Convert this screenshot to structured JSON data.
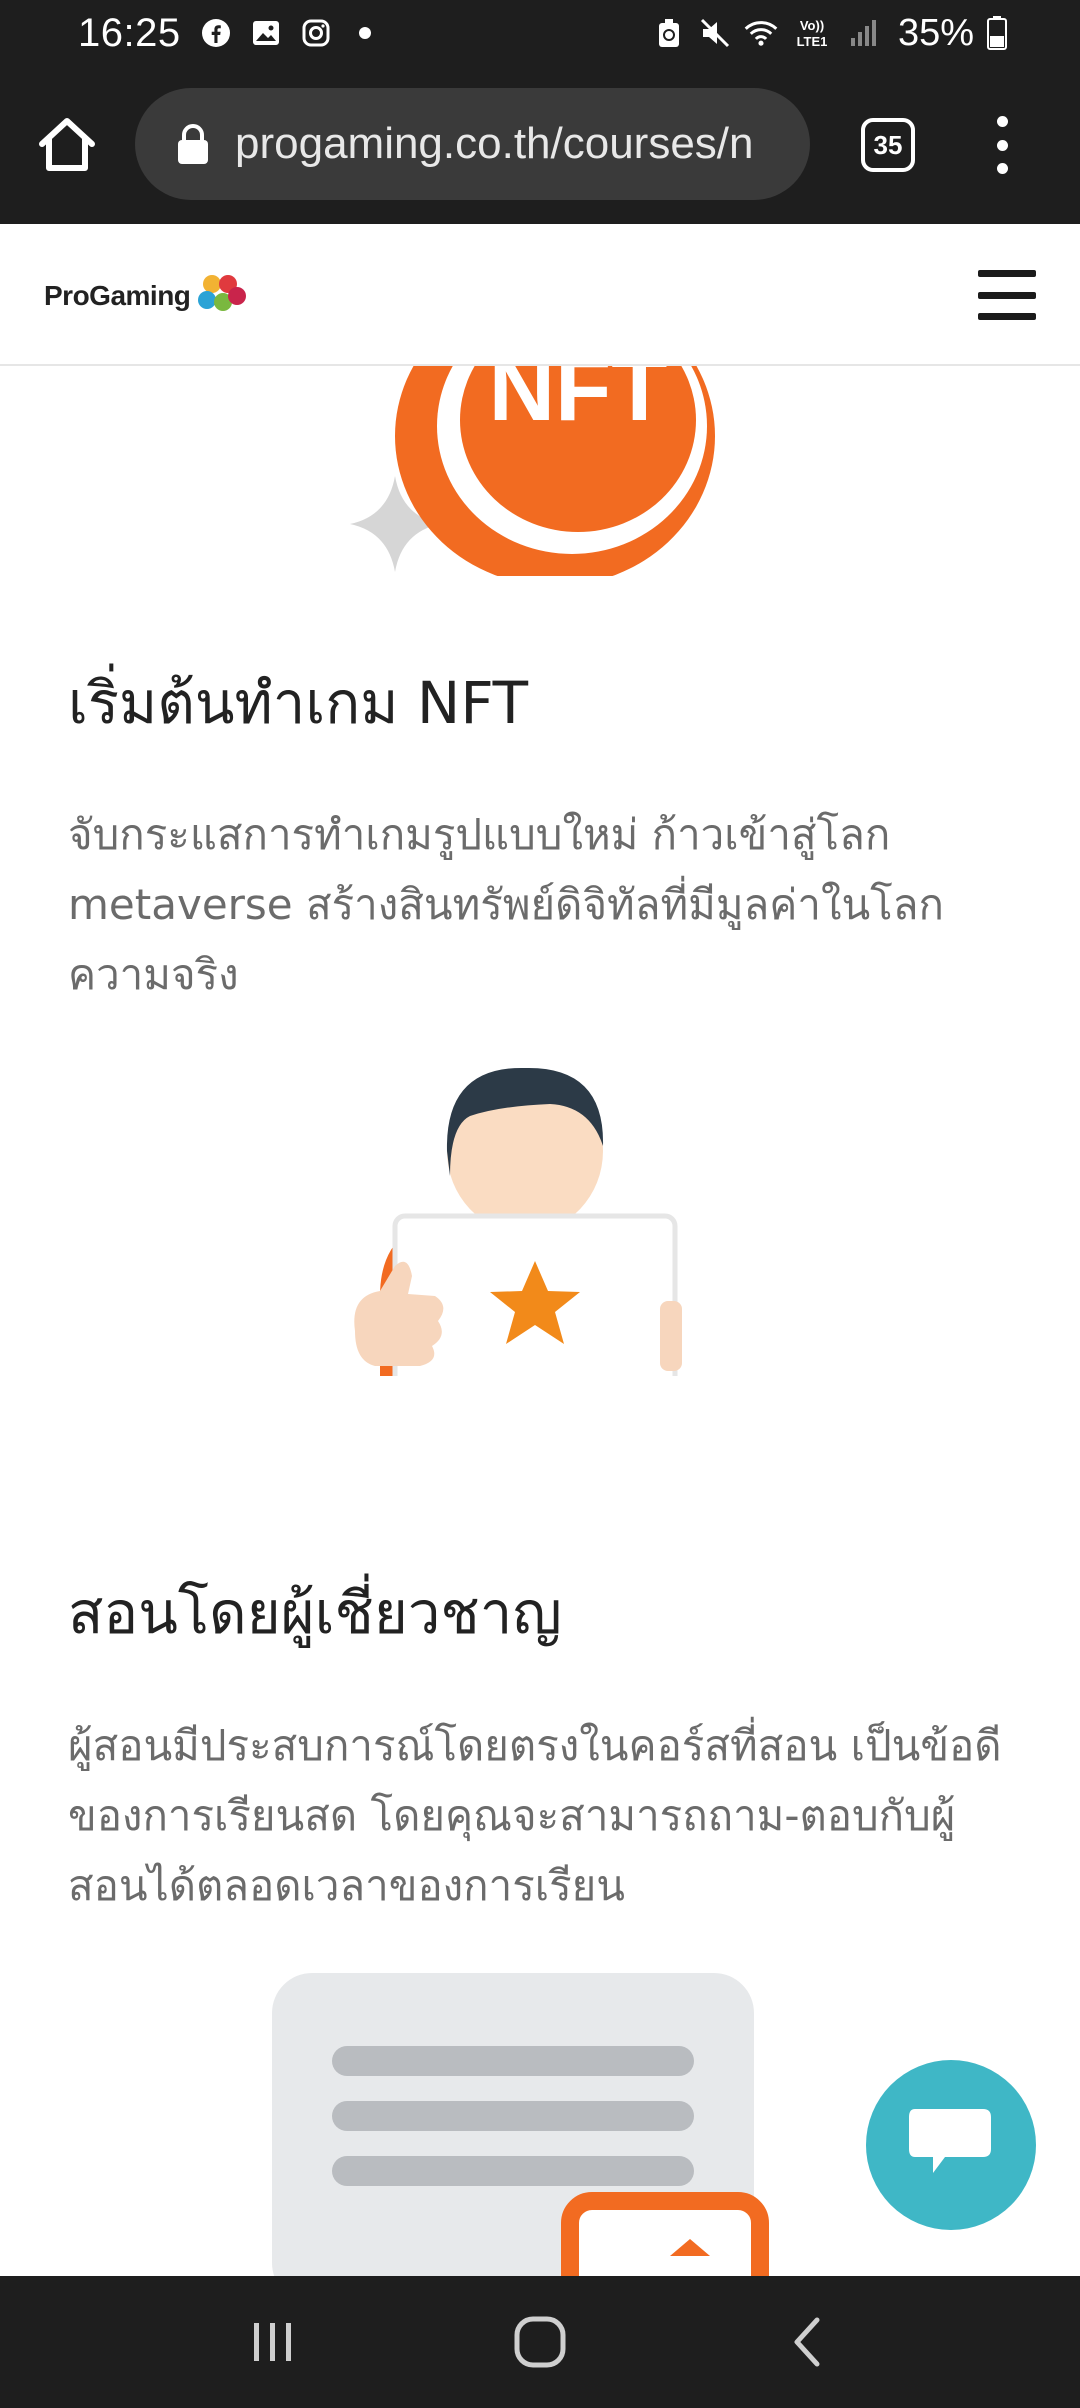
{
  "status_bar": {
    "time": "16:25",
    "battery": "35%",
    "icons_left": [
      "facebook-icon",
      "gallery-icon",
      "instagram-icon",
      "dot-icon"
    ],
    "icons_right": [
      "recycle-icon",
      "mute-icon",
      "wifi-icon",
      "volte-icon",
      "signal-icon",
      "battery-icon"
    ],
    "volte_label": "Vo) LTE1"
  },
  "browser": {
    "url": "progaming.co.th/courses/n",
    "tab_count": "35"
  },
  "site": {
    "logo_text": "ProGaming"
  },
  "sections": [
    {
      "title": "เริ่มต้นทำเกม NFT",
      "description": "จับกระแสการทำเกมรูปแบบใหม่ ก้าวเข้าสู่โลก metaverse สร้างสินทรัพย์ดิจิทัลที่มีมูลค่าในโลกความจริง",
      "illustration_label": "NFT"
    },
    {
      "title": "สอนโดยผู้เชี่ยวชาญ",
      "description": "ผู้สอนมีประสบการณ์โดยตรงในคอร์สที่สอน เป็นข้อดีของการเรียนสด โดยคุณจะสามารถถาม-ตอบกับผู้สอนได้ตลอดเวลาของการเรียน"
    }
  ],
  "colors": {
    "accent_orange": "#f26b21",
    "chat_teal": "#3fb7c6",
    "chrome_dark": "#1e1e1e"
  }
}
